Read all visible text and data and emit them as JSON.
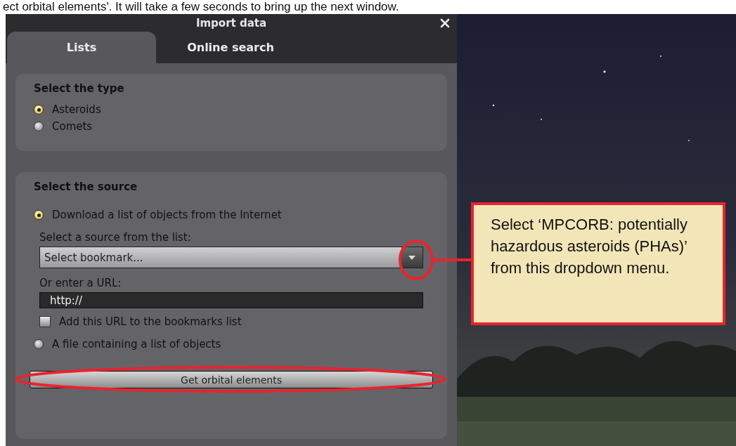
{
  "caption": "ect orbital elements'. It will take a few seconds to bring up the next window.",
  "dialog": {
    "title": "Import data",
    "tabs": [
      {
        "label": "Lists",
        "selected": true
      },
      {
        "label": "Online search",
        "selected": false
      }
    ],
    "type_group": {
      "title": "Select the type",
      "options": [
        {
          "label": "Asteroids",
          "selected": true
        },
        {
          "label": "Comets",
          "selected": false
        }
      ]
    },
    "source_group": {
      "title": "Select the source",
      "download_option": {
        "label": "Download a list of objects from the Internet",
        "selected": true
      },
      "source_label": "Select a source from the list:",
      "bookmark_select": {
        "value": "Select bookmark..."
      },
      "url_label": "Or enter a URL:",
      "url_field": {
        "value": "http://"
      },
      "bookmark_checkbox": {
        "label": "Add this URL to the bookmarks list",
        "checked": false
      },
      "file_option": {
        "label": "A file containing a list of objects",
        "selected": false
      },
      "button": "Get orbital elements"
    }
  },
  "callout": {
    "text": "Select ‘MPCORB: potentially hazardous asteroids (PHAs)’ from this dropdown menu."
  }
}
